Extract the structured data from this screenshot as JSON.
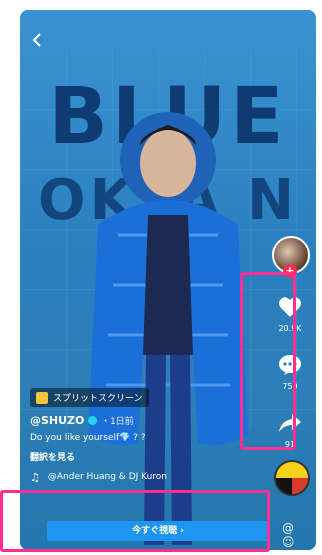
{
  "video": {
    "background_text_1": "BLUE",
    "background_text_2": "OKYA N"
  },
  "nav": {
    "back_icon": "chevron-left-icon"
  },
  "actions": {
    "like_count": "20.9K",
    "comment_count": "759",
    "share_count": "91"
  },
  "info": {
    "tag_label": "スプリットスクリーン",
    "username": "@SHUZO",
    "time": "・1日前",
    "caption": "Do you like yourself💎 ? ?",
    "translate": "翻訳を見る",
    "music": "@Ander Huang & DJ Kuron"
  },
  "cta": {
    "label": "今すぐ視聴 ›"
  },
  "colors": {
    "accent": "#1e96f0",
    "highlight": "#ff2e92",
    "like_red": "#fe2c55"
  }
}
